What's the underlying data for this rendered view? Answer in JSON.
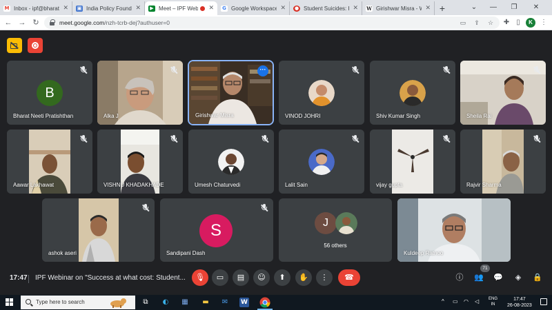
{
  "browser": {
    "tabs": [
      {
        "title": "Inbox - ipf@bharatne",
        "icon": "gmail-icon",
        "color": "#ea4335",
        "glyph": "M",
        "active": false
      },
      {
        "title": "India Policy Foundatio",
        "icon": "site-icon",
        "color": "#4a7bd0",
        "glyph": "▣",
        "active": false
      },
      {
        "title": "Meet – IPF Webin",
        "icon": "meet-icon",
        "color": "#00832d",
        "glyph": "▶",
        "active": true
      },
      {
        "title": "Google Workspace H",
        "icon": "google-icon",
        "color": "#4285f4",
        "glyph": "G",
        "active": false
      },
      {
        "title": "Student Suicides: How",
        "icon": "site-icon",
        "color": "#d93025",
        "glyph": "●",
        "active": false
      },
      {
        "title": "Girishwar Misra - Wiki",
        "icon": "wikipedia-icon",
        "color": "#ffffff",
        "glyph": "W",
        "active": false
      }
    ],
    "url_host": "meet.google.com",
    "url_path": "/nzh-tcrb-dej?authuser=0",
    "profile_initial": "K"
  },
  "participants": [
    {
      "name": "Bharat Neeti Pratishthan",
      "type": "letter",
      "letter": "B",
      "color": "#33691e"
    },
    {
      "name": "Alka J",
      "type": "video"
    },
    {
      "name": "Girishwar Misra",
      "type": "video",
      "speaking": true
    },
    {
      "name": "VINOD JOHRI",
      "type": "photo"
    },
    {
      "name": "Shiv Kumar Singh",
      "type": "photo"
    },
    {
      "name": "Sheila Rai",
      "type": "video"
    },
    {
      "name": "Aawar Lakhawat",
      "type": "video"
    },
    {
      "name": "VISHNU KHADAKHADE",
      "type": "video"
    },
    {
      "name": "Umesh Chaturvedi",
      "type": "photo"
    },
    {
      "name": "Lalit Sain",
      "type": "photo"
    },
    {
      "name": "vijay gupta",
      "type": "video"
    },
    {
      "name": "Rajvir Sharma",
      "type": "video"
    },
    {
      "name": "ashok aseri",
      "type": "video"
    },
    {
      "name": "Sandipani Dash",
      "type": "letter",
      "letter": "S",
      "color": "#d81b60"
    },
    {
      "name": "56 others",
      "type": "others",
      "letter": "J",
      "color": "#6d4c41"
    },
    {
      "name": "Kuldeep Ratnoo",
      "type": "video"
    }
  ],
  "controls": {
    "time": "17:47",
    "meeting_title": "IPF Webinar on \"Success at what cost: Student...",
    "participant_count": "71"
  },
  "taskbar": {
    "search_placeholder": "Type here to search",
    "lang": "ENG",
    "region": "IN",
    "time": "17:47",
    "date": "26-08-2023"
  }
}
